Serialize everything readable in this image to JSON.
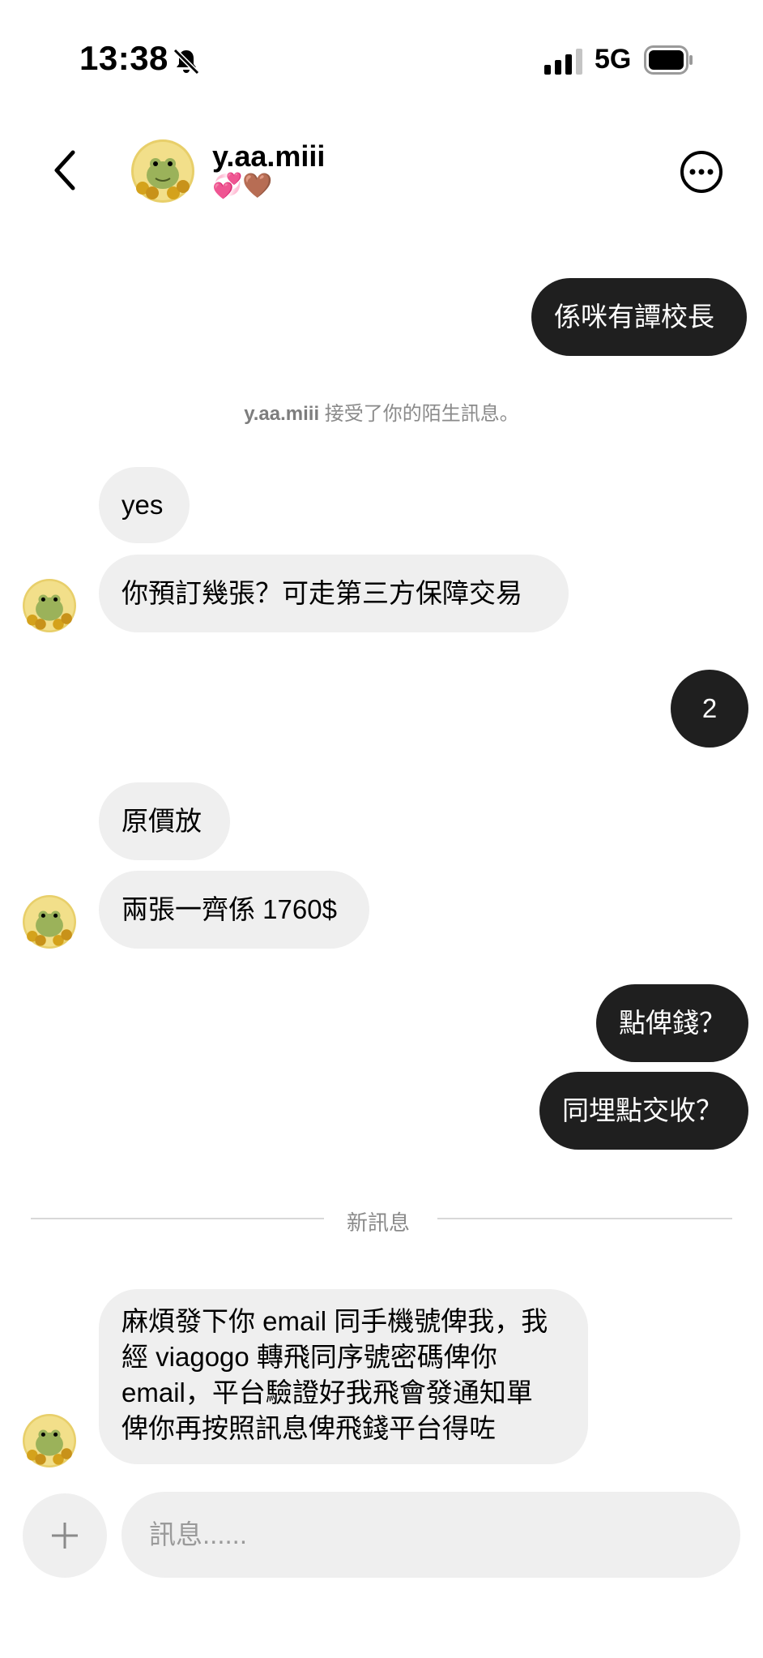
{
  "status_bar": {
    "time": "13:38",
    "network": "5G"
  },
  "header": {
    "username": "y.aa.miii",
    "status_emoji": "💞🤎"
  },
  "messages": [
    {
      "from": "me",
      "text": "係咪有譚校長"
    },
    {
      "from": "system",
      "user": "y.aa.miii",
      "text": " 接受了你的陌生訊息。"
    },
    {
      "from": "them",
      "text": "yes"
    },
    {
      "from": "them",
      "text": "你預訂幾張？可走第三方保障交易"
    },
    {
      "from": "me",
      "text": "2"
    },
    {
      "from": "them",
      "text": "原價放"
    },
    {
      "from": "them",
      "text": "兩張一齊係 1760$"
    },
    {
      "from": "me",
      "text": "點俾錢？"
    },
    {
      "from": "me",
      "text": "同埋點交收？"
    },
    {
      "from": "them",
      "lines": [
        "麻煩發下你 email 同手機號俾我，我",
        "經 viagogo 轉飛同序號密碼俾你",
        "email，平台驗證好我飛會發通知單",
        "俾你再按照訊息俾飛錢平台得咗"
      ]
    }
  ],
  "new_messages_label": "新訊息",
  "composer": {
    "placeholder": "訊息......",
    "value": ""
  }
}
